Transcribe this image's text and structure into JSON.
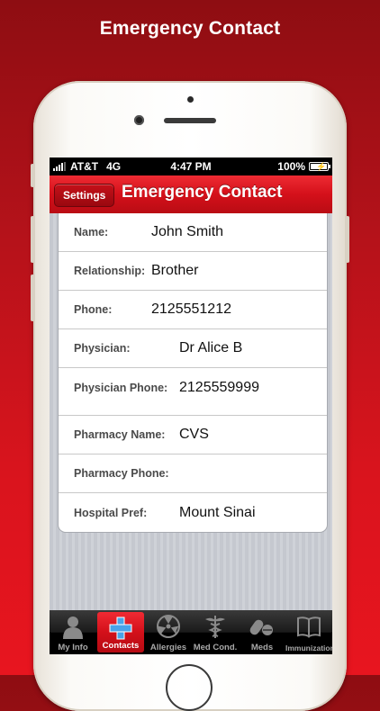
{
  "headline": "Emergency Contact",
  "status_bar": {
    "carrier": "AT&T",
    "network": "4G",
    "time": "4:47 PM",
    "battery": "100%"
  },
  "nav": {
    "back_label": "Settings",
    "title": "Emergency Contact"
  },
  "fields": [
    {
      "label": "Name:",
      "value": "John Smith"
    },
    {
      "label": "Relationship:",
      "value": "Brother"
    },
    {
      "label": "Phone:",
      "value": "2125551212"
    },
    {
      "label": "Physician:",
      "value": "Dr Alice B"
    },
    {
      "label": "Physician Phone:",
      "value": "2125559999"
    },
    {
      "label": "Pharmacy Name:",
      "value": "CVS"
    },
    {
      "label": "Pharmacy Phone:",
      "value": ""
    },
    {
      "label": "Hospital Pref:",
      "value": "Mount Sinai"
    }
  ],
  "tabs": [
    {
      "label": "My Info",
      "icon": "person-icon"
    },
    {
      "label": "Contacts",
      "icon": "medical-cross-icon",
      "active": true
    },
    {
      "label": "Allergies",
      "icon": "radiation-icon"
    },
    {
      "label": "Med Cond.",
      "icon": "caduceus-icon"
    },
    {
      "label": "Meds",
      "icon": "pills-icon"
    },
    {
      "label": "Immunization",
      "icon": "book-icon"
    }
  ],
  "colors": {
    "accent": "#d4101a",
    "background": "#b5121a"
  }
}
